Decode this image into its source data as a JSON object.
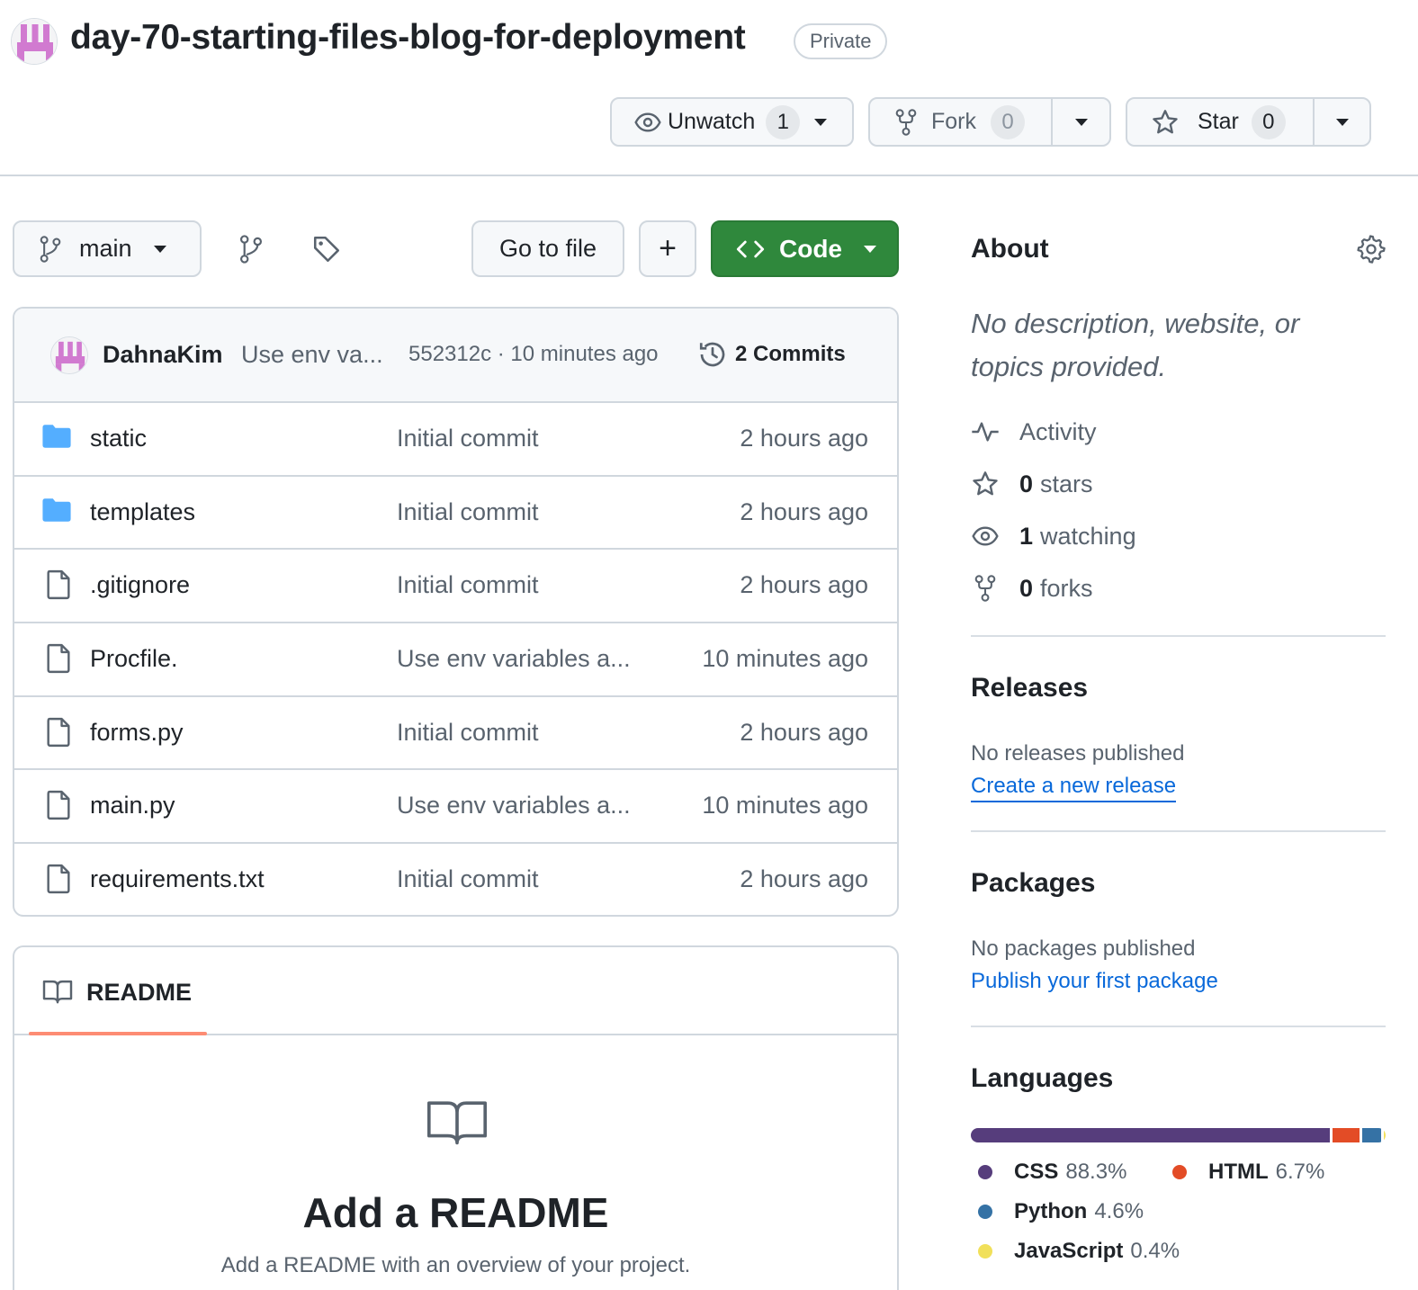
{
  "repo": {
    "name": "day-70-starting-files-blog-for-deployment",
    "visibility": "Private"
  },
  "actions": {
    "unwatch_label": "Unwatch",
    "watch_count": "1",
    "fork_label": "Fork",
    "fork_count": "0",
    "star_label": "Star",
    "star_count": "0"
  },
  "toolbar": {
    "branch": "main",
    "go_to_file": "Go to file",
    "add": "+",
    "code": "Code"
  },
  "commit": {
    "author": "DahnaKim",
    "message": "Use env va...",
    "hash_time": "552312c · 10 minutes ago",
    "commits": "2 Commits"
  },
  "files": [
    {
      "name": "static",
      "type": "folder",
      "message": "Initial commit",
      "time": "2 hours ago"
    },
    {
      "name": "templates",
      "type": "folder",
      "message": "Initial commit",
      "time": "2 hours ago"
    },
    {
      "name": ".gitignore",
      "type": "file",
      "message": "Initial commit",
      "time": "2 hours ago"
    },
    {
      "name": "Procfile.",
      "type": "file",
      "message": "Use env variables a...",
      "time": "10 minutes ago"
    },
    {
      "name": "forms.py",
      "type": "file",
      "message": "Initial commit",
      "time": "2 hours ago"
    },
    {
      "name": "main.py",
      "type": "file",
      "message": "Use env variables a...",
      "time": "10 minutes ago"
    },
    {
      "name": "requirements.txt",
      "type": "file",
      "message": "Initial commit",
      "time": "2 hours ago"
    }
  ],
  "readme": {
    "tab": "README",
    "title": "Add a README",
    "subtitle": "Add a README with an overview of your project."
  },
  "about": {
    "heading": "About",
    "description": "No description, website, or topics provided.",
    "activity": "Activity",
    "stars_count": "0",
    "stars_label": "stars",
    "watching_count": "1",
    "watching_label": "watching",
    "forks_count": "0",
    "forks_label": "forks"
  },
  "releases": {
    "heading": "Releases",
    "empty": "No releases published",
    "link": "Create a new release"
  },
  "packages": {
    "heading": "Packages",
    "empty": "No packages published",
    "link": "Publish your first package"
  },
  "languages": {
    "heading": "Languages",
    "items": [
      {
        "name": "CSS",
        "percent": "88.3%",
        "value": 88.3,
        "color": "#563d7c"
      },
      {
        "name": "HTML",
        "percent": "6.7%",
        "value": 6.7,
        "color": "#e34c26"
      },
      {
        "name": "Python",
        "percent": "4.6%",
        "value": 4.6,
        "color": "#3572A5"
      },
      {
        "name": "JavaScript",
        "percent": "0.4%",
        "value": 0.4,
        "color": "#f1e05a"
      }
    ]
  },
  "colors": {
    "code_button": "#2f883c",
    "link": "#0969da",
    "readme_underline": "#fd8c73",
    "folder": "#54aeff"
  }
}
